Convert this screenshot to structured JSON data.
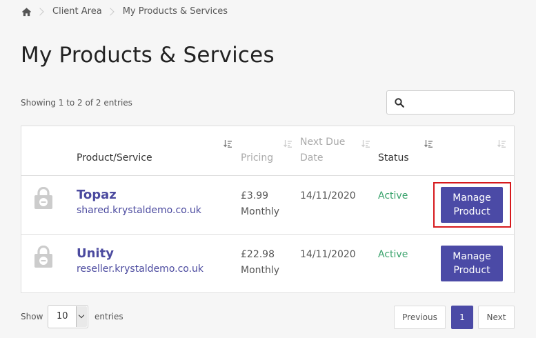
{
  "breadcrumb": {
    "home_icon": "home-icon",
    "items": [
      "Client Area",
      "My Products & Services"
    ]
  },
  "page_title": "My Products & Services",
  "table_info": "Showing 1 to 2 of 2 entries",
  "search": {
    "icon": "search-icon",
    "value": "",
    "placeholder": ""
  },
  "table": {
    "headers": {
      "product": "Product/Service",
      "pricing": "Pricing",
      "next_due_line1": "Next Due",
      "next_due_line2": "Date",
      "status": "Status"
    },
    "rows": [
      {
        "icon": "lock-icon",
        "name": "Topaz",
        "domain": "shared.krystaldemo.co.uk",
        "price": "£3.99",
        "cycle": "Monthly",
        "next_due": "14/11/2020",
        "status": "Active",
        "button": "Manage\nProduct",
        "highlighted": true
      },
      {
        "icon": "lock-icon",
        "name": "Unity",
        "domain": "reseller.krystaldemo.co.uk",
        "price": "£22.98",
        "cycle": "Monthly",
        "next_due": "14/11/2020",
        "status": "Active",
        "button": "Manage\nProduct",
        "highlighted": false
      }
    ]
  },
  "length": {
    "show_label": "Show",
    "selected": "10",
    "entries_label": "entries"
  },
  "pagination": {
    "previous": "Previous",
    "current": "1",
    "next": "Next"
  },
  "colors": {
    "accent": "#4b4aa6",
    "link": "#4b4a9f",
    "status_active": "#3aa36c",
    "highlight": "#d6191d"
  }
}
